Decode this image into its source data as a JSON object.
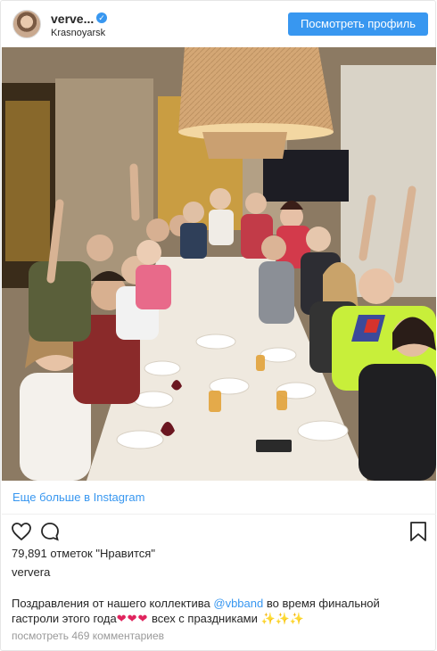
{
  "header": {
    "username": "verve...",
    "location": "Krasnoyarsk",
    "view_profile_label": "Посмотреть профиль"
  },
  "photo": {
    "alt": ""
  },
  "more_link": "Еще больше в Instagram",
  "actions": {
    "like_icon": "heart-outline-icon",
    "comment_icon": "comment-bubble-icon",
    "save_icon": "bookmark-icon"
  },
  "likes_text": "79,891 отметок \"Нравится\"",
  "owner": "ververa",
  "caption": {
    "before": "Поздравления от нашего коллектива ",
    "mention": "@vbband",
    "after": " во время финальной гастроли этого года",
    "hearts": "❤❤❤",
    "after2": " всех с праздниками ",
    "emoji": "✨✨✨"
  },
  "comments_link": "посмотреть 469 комментариев",
  "colors": {
    "accent": "#3897f0",
    "text": "#262626",
    "muted": "#999999",
    "heart": "#e0245e"
  }
}
